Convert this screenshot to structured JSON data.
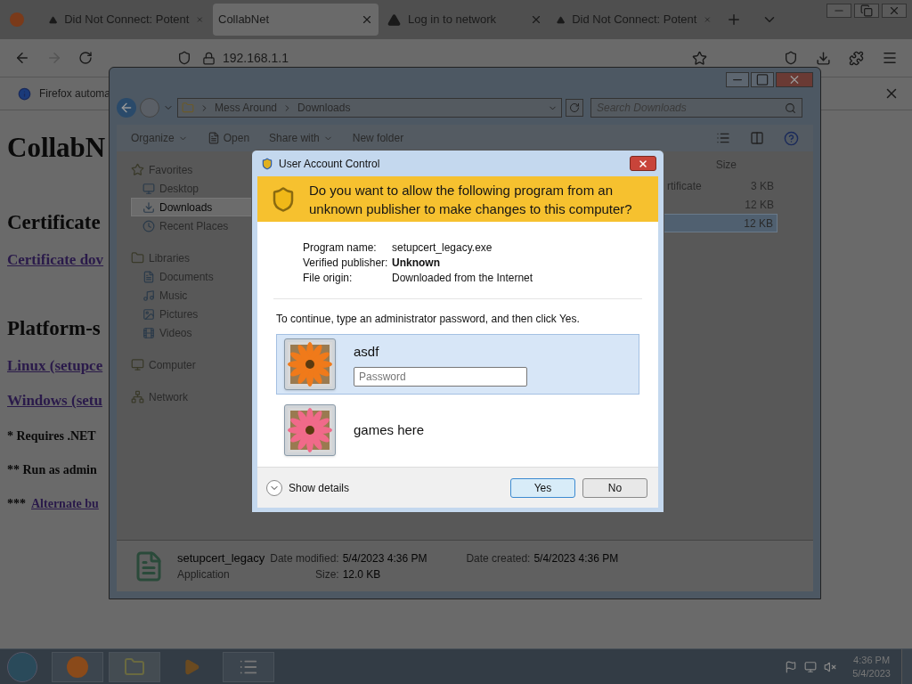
{
  "browser": {
    "tabs": [
      {
        "title": "Did Not Connect: Potent",
        "warning": true,
        "selected": false
      },
      {
        "title": "CollabNet",
        "warning": false,
        "selected": true
      },
      {
        "title": "Log in to network",
        "warning": true,
        "selected": false
      },
      {
        "title": "Did Not Connect: Potent",
        "warning": true,
        "selected": false
      }
    ],
    "url": "192.168.1.1",
    "notification": "Firefox automa",
    "page": [
      {
        "kind": "h1",
        "text": "CollabN"
      },
      {
        "kind": "h2",
        "text": "Certificate"
      },
      {
        "kind": "link",
        "text": "Certificate dov"
      },
      {
        "kind": "h2",
        "text": "Platform-s"
      },
      {
        "kind": "link",
        "text": "Linux (setupce"
      },
      {
        "kind": "link",
        "text": "Windows (setu"
      },
      {
        "kind": "note",
        "text": "* Requires .NET"
      },
      {
        "kind": "note",
        "text": "** Run as admin"
      },
      {
        "kind": "notelink",
        "text": "***",
        "link": "Alternate bu"
      }
    ]
  },
  "explorer": {
    "breadcrumb": [
      "Mess Around",
      "Downloads"
    ],
    "search": {
      "placeholder": "Search Downloads"
    },
    "toolbar": [
      {
        "label": "Organize",
        "menu": true
      },
      {
        "label": "Open",
        "menu": false
      },
      {
        "label": "Share with",
        "menu": true
      },
      {
        "label": "New folder",
        "menu": false
      }
    ],
    "nav": [
      {
        "label": "Favorites",
        "children": [
          {
            "label": "Desktop",
            "selected": false
          },
          {
            "label": "Downloads",
            "selected": true
          },
          {
            "label": "Recent Places",
            "selected": false
          }
        ]
      },
      {
        "label": "Libraries",
        "children": [
          {
            "label": "Documents",
            "selected": false
          },
          {
            "label": "Music",
            "selected": false
          },
          {
            "label": "Pictures",
            "selected": false
          },
          {
            "label": "Videos",
            "selected": false
          }
        ]
      },
      {
        "label": "Computer"
      },
      {
        "label": "Network"
      }
    ],
    "column": "Size",
    "rows": [
      {
        "name": "rtificate",
        "size": "3 KB",
        "selected": false
      },
      {
        "size": "12 KB",
        "selected": false
      },
      {
        "size": "12 KB",
        "selected": true
      }
    ],
    "details": {
      "name": "setupcert_legacy",
      "type": "Application",
      "fields": [
        {
          "label": "Date modified:",
          "value": "5/4/2023 4:36 PM"
        },
        {
          "label": "Size:",
          "value": "12.0 KB"
        },
        {
          "label": "Date created:",
          "value": "5/4/2023 4:36 PM"
        }
      ]
    }
  },
  "uac": {
    "title": "User Account Control",
    "question": "Do you want to allow the following program from an unknown publisher to make changes to this computer?",
    "info": [
      {
        "label": "Program name:",
        "value": "setupcert_legacy.exe",
        "bold": false
      },
      {
        "label": "Verified publisher:",
        "value": "Unknown",
        "bold": true
      },
      {
        "label": "File origin:",
        "value": "Downloaded from the Internet",
        "bold": false
      }
    ],
    "instruction": "To continue, type an administrator password, and then click Yes.",
    "accounts": [
      {
        "name": "asdf",
        "selected": true,
        "placeholder": "Password"
      },
      {
        "name": "games here",
        "selected": false
      }
    ],
    "show_details": "Show details",
    "buttons": [
      {
        "label": "Yes",
        "default": true
      },
      {
        "label": "No",
        "default": false
      }
    ]
  },
  "taskbar": {
    "time": "4:36 PM",
    "date": "5/4/2023"
  }
}
